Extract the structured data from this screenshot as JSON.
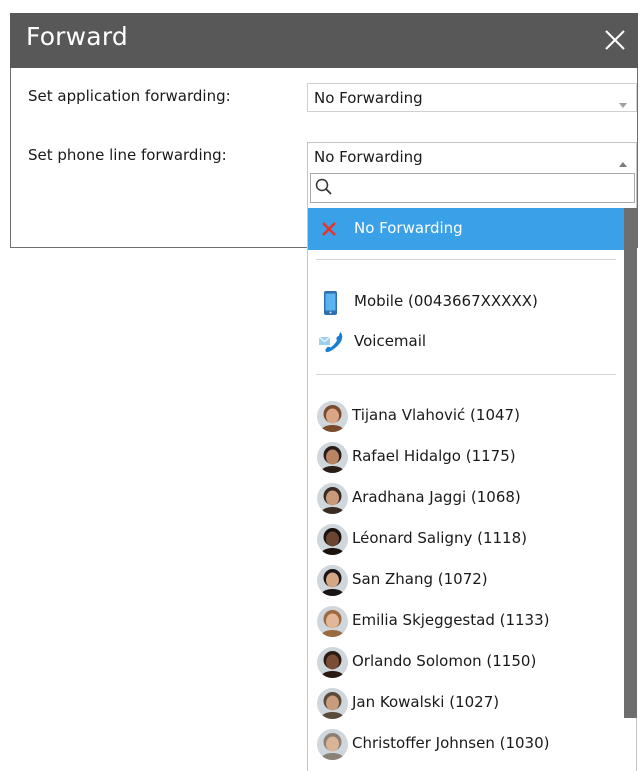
{
  "dialog": {
    "title": "Forward",
    "close_icon": "close-icon"
  },
  "application_forwarding": {
    "label": "Set application forwarding:",
    "value": "No Forwarding"
  },
  "phone_line_forwarding": {
    "label": "Set phone line forwarding:",
    "value": "No Forwarding"
  },
  "dropdown": {
    "search_placeholder": "",
    "selected_option": {
      "label": "No Forwarding",
      "icon": "red-x-icon"
    },
    "options": [
      {
        "label": "Mobile (0043667XXXXX)",
        "icon": "mobile-phone-icon"
      },
      {
        "label": "Voicemail",
        "icon": "voicemail-icon"
      }
    ],
    "contacts": [
      {
        "label": "Tijana Vlahović (1047)",
        "skin": "#d9a787",
        "hair": "#7a4a2c"
      },
      {
        "label": "Rafael Hidalgo (1175)",
        "skin": "#b98464",
        "hair": "#2a1d16"
      },
      {
        "label": "Aradhana Jaggi (1068)",
        "skin": "#c99a7a",
        "hair": "#3a2a22"
      },
      {
        "label": "Léonard Saligny (1118)",
        "skin": "#6a4632",
        "hair": "#1c120d"
      },
      {
        "label": "San Zhang (1072)",
        "skin": "#d4a682",
        "hair": "#1a1514"
      },
      {
        "label": "Emilia Skjeggestad (1133)",
        "skin": "#e2b799",
        "hair": "#9b6a3f"
      },
      {
        "label": "Orlando Solomon (1150)",
        "skin": "#7a4d35",
        "hair": "#2a1a12"
      },
      {
        "label": "Jan Kowalski (1027)",
        "skin": "#c79d7d",
        "hair": "#5a4a3a"
      },
      {
        "label": "Christoffer Johnsen (1030)",
        "skin": "#d9b496",
        "hair": "#8a8074"
      }
    ]
  },
  "colors": {
    "titlebar": "#585858",
    "selected": "#3aa1e9",
    "scrollbar": "#6e6e6e"
  }
}
